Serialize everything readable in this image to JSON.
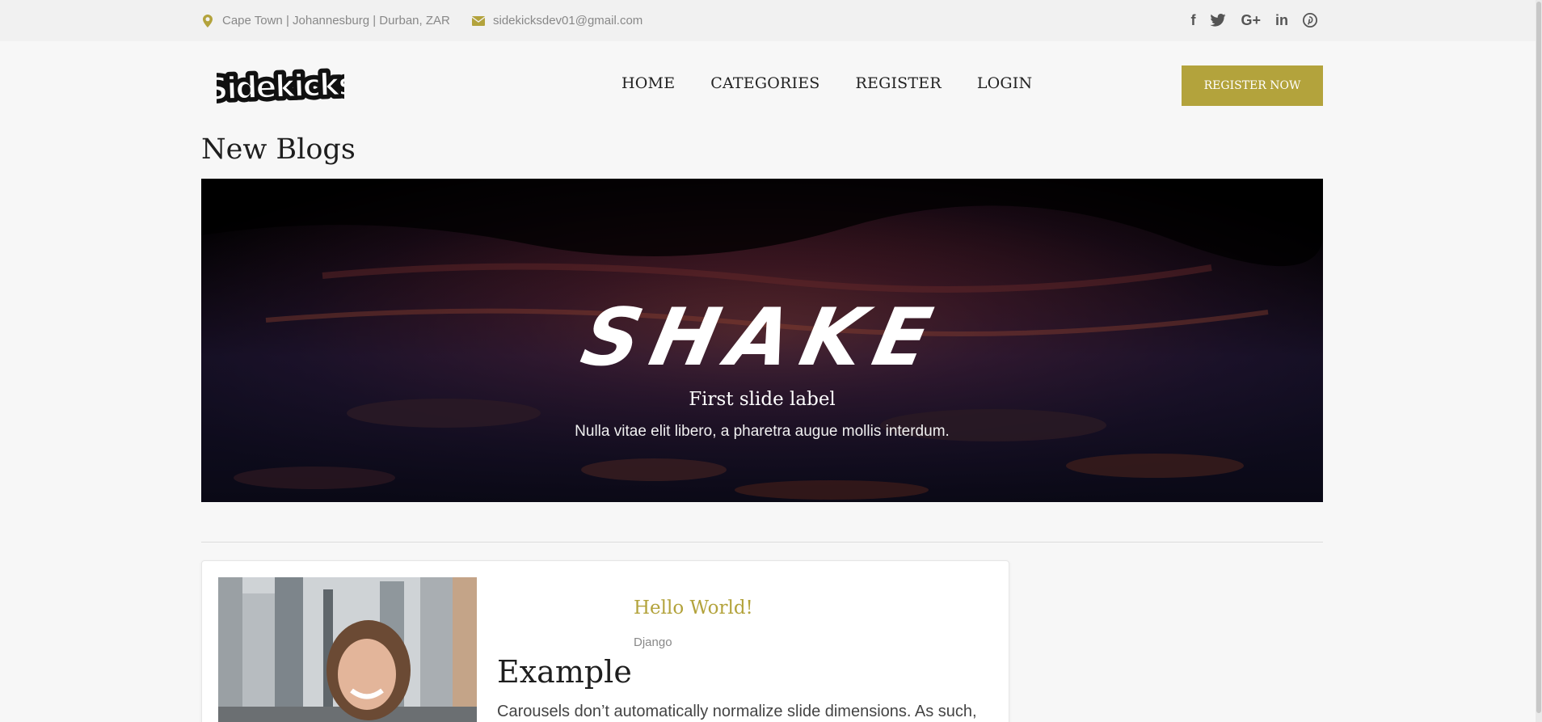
{
  "topbar": {
    "location": "Cape Town | Johannesburg | Durban, ZAR",
    "email": "sidekicksdev01@gmail.com",
    "social": [
      "facebook-icon",
      "twitter-icon",
      "google-plus-icon",
      "linkedin-icon",
      "pinterest-icon"
    ],
    "social_glyphs": [
      "f",
      "t",
      "G+",
      "in",
      "p"
    ]
  },
  "brand": {
    "logo_text": "Sidekicks"
  },
  "nav": {
    "items": [
      "HOME",
      "CATEGORIES",
      "REGISTER",
      "LOGIN"
    ]
  },
  "cta": {
    "label": "REGISTER NOW"
  },
  "page": {
    "title": "New Blogs"
  },
  "hero": {
    "headline": "SHAKE",
    "label": "First slide label",
    "text": "Nulla vitae elit libero, a pharetra augue mollis interdum."
  },
  "post": {
    "title": "Hello World!",
    "category": "Django",
    "heading": "Example",
    "body": "Carousels don’t automatically normalize slide dimensions. As such,"
  },
  "colors": {
    "accent": "#b3a33c",
    "topbar_bg": "#f1f1f1",
    "page_bg": "#f7f7f7"
  }
}
